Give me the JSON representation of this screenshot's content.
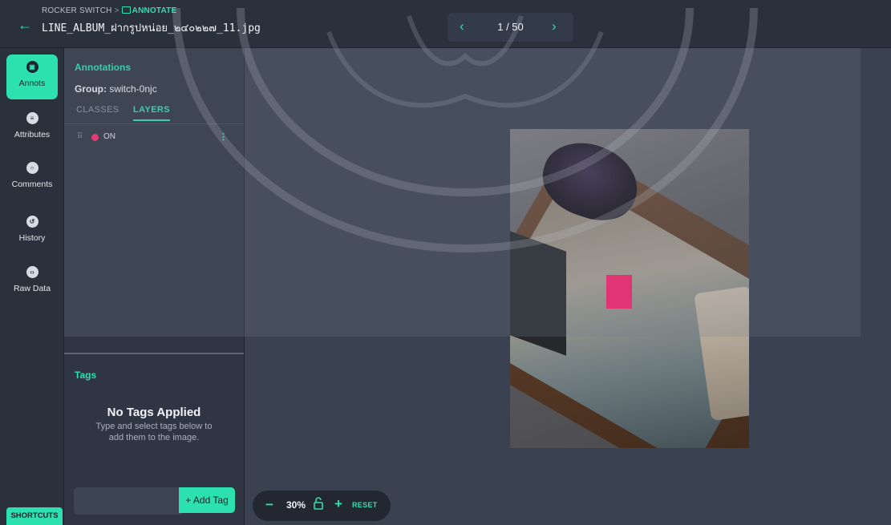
{
  "header": {
    "breadcrumb_project": "ROCKER SWITCH",
    "breadcrumb_separator": ">",
    "breadcrumb_current": "ANNOTATE",
    "filename": "LINE_ALBUM_ฝากรูปหน่อย_๒๔๐๒๒๗_11.jpg",
    "page_indicator": "1 / 50",
    "back_icon": "arrow-left-icon",
    "prev_icon": "chevron-left-icon",
    "next_icon": "chevron-right-icon"
  },
  "sidebar": {
    "items": [
      {
        "label": "Annots",
        "icon": "annotations-icon",
        "active": true
      },
      {
        "label": "Attributes",
        "icon": "list-icon",
        "active": false
      },
      {
        "label": "Comments",
        "icon": "comment-icon",
        "active": false
      },
      {
        "label": "History",
        "icon": "history-icon",
        "active": false
      },
      {
        "label": "Raw Data",
        "icon": "code-icon",
        "active": false
      }
    ],
    "shortcuts_label": "SHORTCUTS"
  },
  "panel": {
    "title": "Annotations",
    "group_label": "Group:",
    "group_value": "switch-0njc",
    "tabs": [
      {
        "label": "CLASSES",
        "active": false
      },
      {
        "label": "LAYERS",
        "active": true
      }
    ],
    "layers": [
      {
        "name": "ON",
        "color": "#ff2b6a"
      }
    ],
    "more_icon": "more-vertical-icon"
  },
  "tags": {
    "title": "Tags",
    "empty_title": "No Tags Applied",
    "empty_subtitle": "Type and select tags below to add them to the image.",
    "input_value": "",
    "add_button_label": "+ Add Tag"
  },
  "zoom": {
    "minus_label": "−",
    "level": "30%",
    "lock_icon": "unlock-icon",
    "plus_label": "+",
    "reset_label": "RESET"
  },
  "colors": {
    "accent": "#2de0b0",
    "annotation": "#ff1f6e"
  }
}
